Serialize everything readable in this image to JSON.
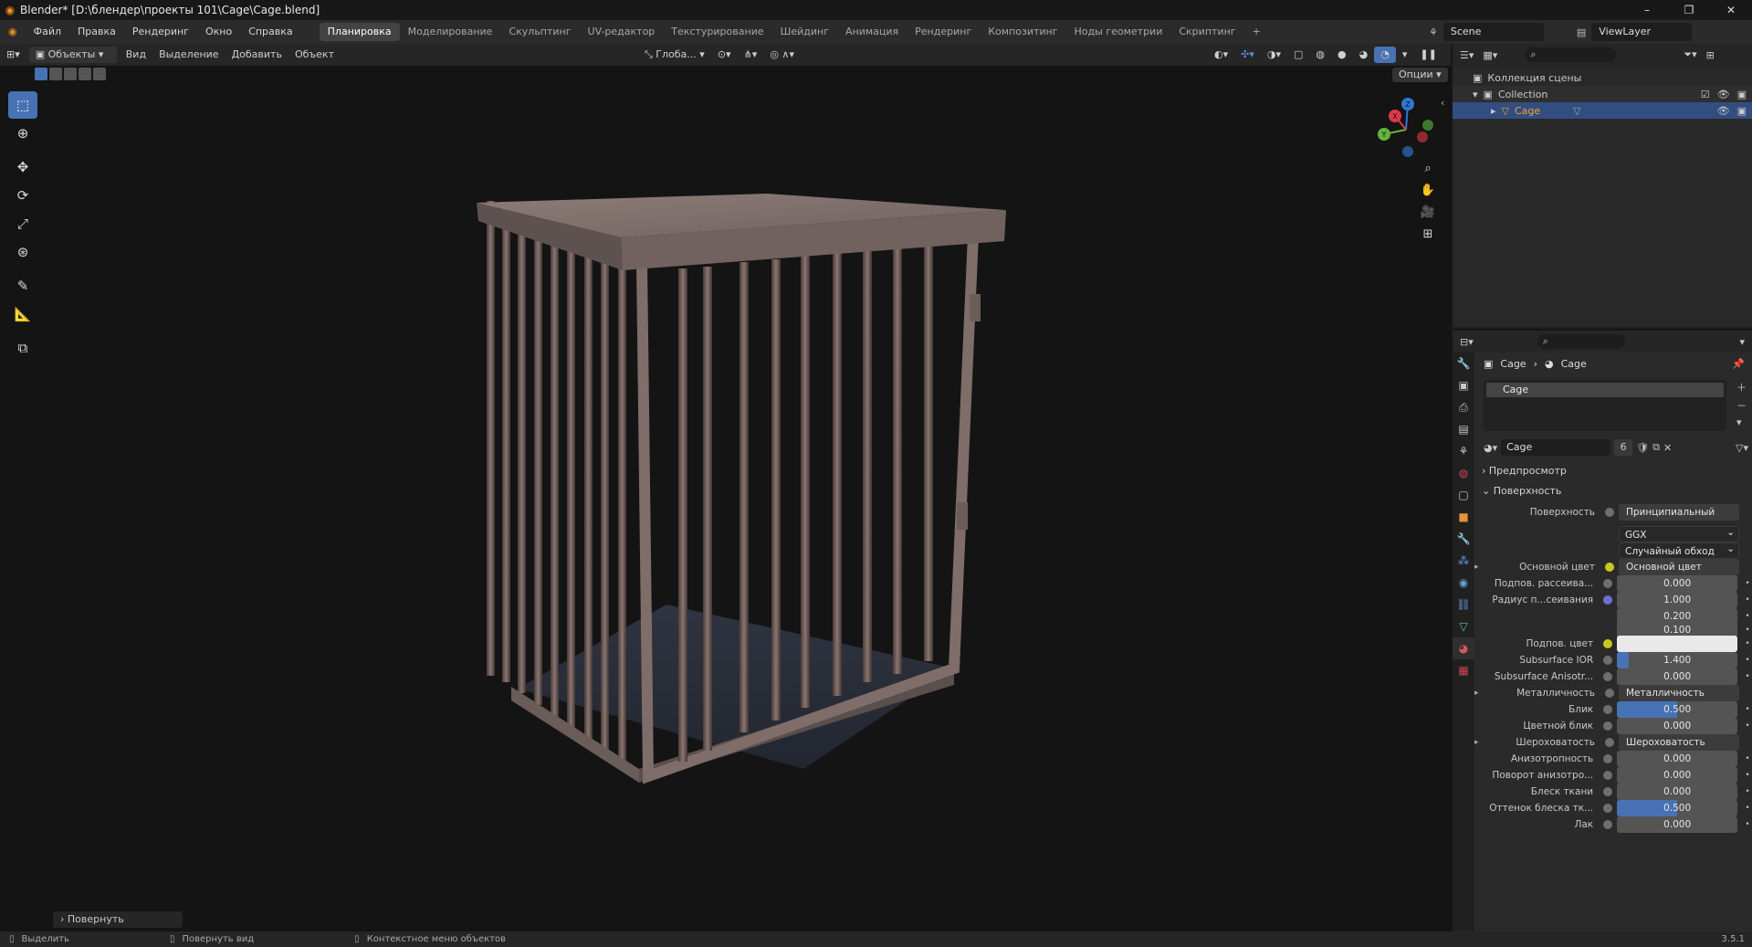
{
  "titlebar": {
    "title": "Blender* [D:\\блендер\\проекты 101\\Cage\\Cage.blend]",
    "minimize": "–",
    "maximize": "❐",
    "close": "✕"
  },
  "menu": {
    "items": [
      "Файл",
      "Правка",
      "Рендеринг",
      "Окно",
      "Справка"
    ]
  },
  "workspaces": {
    "tabs": [
      "Планировка",
      "Моделирование",
      "Скульптинг",
      "UV-редактор",
      "Текстурирование",
      "Шейдинг",
      "Анимация",
      "Рендеринг",
      "Композитинг",
      "Ноды геометрии",
      "Скриптинг"
    ],
    "active_index": 0,
    "add": "+"
  },
  "scene": {
    "name": "Scene",
    "view_layer": "ViewLayer"
  },
  "viewport_header": {
    "mode": "Объекты",
    "menus": [
      "Вид",
      "Выделение",
      "Добавить",
      "Объект"
    ],
    "orientation": "Глоба...",
    "options": "Опции"
  },
  "toolbar": {
    "tools": [
      "select-box-icon",
      "cursor-icon",
      "move-icon",
      "rotate-icon",
      "scale-icon",
      "transform-icon",
      "annotate-icon",
      "measure-icon",
      "add-cube-icon"
    ],
    "active_index": 0
  },
  "gizmo": {
    "z": "Z",
    "y": "Y",
    "x": "X"
  },
  "last_operator": "Повернуть",
  "outliner": {
    "root": "Коллекция сцены",
    "collection": "Collection",
    "object": "Cage"
  },
  "properties": {
    "breadcrumb_object": "Cage",
    "breadcrumb_material": "Cage",
    "slot": "Cage",
    "material_name": "Cage",
    "users": "6",
    "preview_label": "Предпросмотр",
    "surface_label": "Поверхность",
    "rows": [
      {
        "label": "Поверхность",
        "value": "Принципиальный BSDF",
        "kind": "link",
        "dot": "g"
      },
      {
        "label": "",
        "value": "GGX",
        "kind": "dropdown"
      },
      {
        "label": "",
        "value": "Случайный обход",
        "kind": "dropdown"
      },
      {
        "label": "Основной цвет",
        "value": "Основной цвет",
        "kind": "link",
        "dot": "y",
        "expand": true
      },
      {
        "label": "Подпов. рассеива...",
        "value": "0.000",
        "kind": "num",
        "dot": "g"
      },
      {
        "label": "Радиус п...сеивания",
        "value": "1.000",
        "kind": "num",
        "dot": "b"
      },
      {
        "label": "",
        "value": "0.200",
        "kind": "num"
      },
      {
        "label": "",
        "value": "0.100",
        "kind": "num"
      },
      {
        "label": "Подпов. цвет",
        "value": "",
        "kind": "white",
        "dot": "y"
      },
      {
        "label": "Subsurface IOR",
        "value": "1.400",
        "kind": "num",
        "dot": "g",
        "fill": 0.1
      },
      {
        "label": "Subsurface Anisotr...",
        "value": "0.000",
        "kind": "num",
        "dot": "g"
      },
      {
        "label": "Металличность",
        "value": "Металличность",
        "kind": "link",
        "dot": "g",
        "expand": true
      },
      {
        "label": "Блик",
        "value": "0.500",
        "kind": "num",
        "dot": "g",
        "fill": 0.5
      },
      {
        "label": "Цветной блик",
        "value": "0.000",
        "kind": "num",
        "dot": "g"
      },
      {
        "label": "Шероховатость",
        "value": "Шероховатость",
        "kind": "link",
        "dot": "g",
        "expand": true
      },
      {
        "label": "Анизотропность",
        "value": "0.000",
        "kind": "num",
        "dot": "g"
      },
      {
        "label": "Поворот анизотро...",
        "value": "0.000",
        "kind": "num",
        "dot": "g"
      },
      {
        "label": "Блеск ткани",
        "value": "0.000",
        "kind": "num",
        "dot": "g"
      },
      {
        "label": "Оттенок блеска тк...",
        "value": "0.500",
        "kind": "num",
        "dot": "g",
        "fill": 0.5
      },
      {
        "label": "Лак",
        "value": "0.000",
        "kind": "num",
        "dot": "g"
      }
    ]
  },
  "statusbar": {
    "select": "Выделить",
    "rotate_view": "Повернуть вид",
    "context_menu": "Контекстное меню объектов",
    "version": "3.5.1"
  },
  "colors": {
    "accent": "#4772b3",
    "active_tab": "#434343",
    "selected_row": "#334d80"
  }
}
